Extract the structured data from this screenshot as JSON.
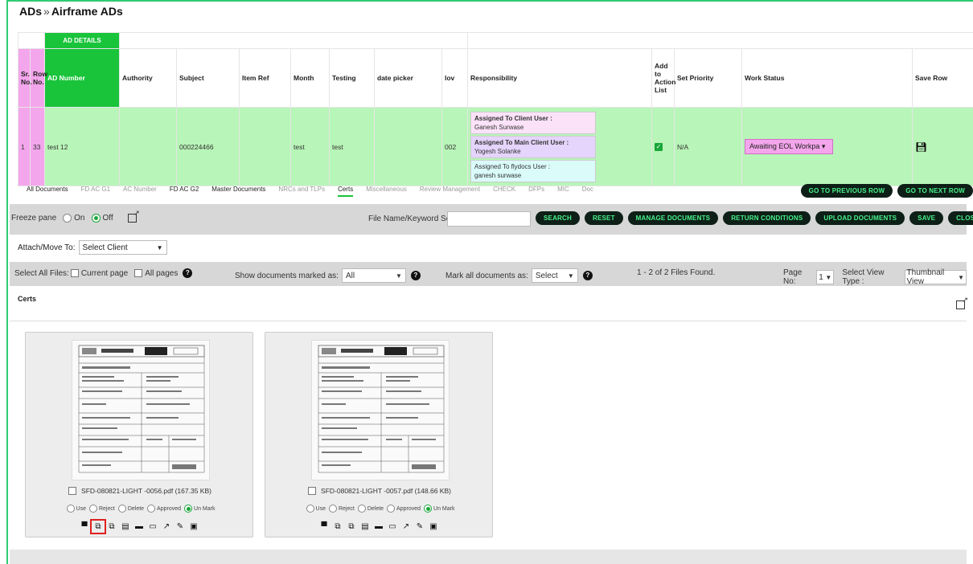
{
  "page": {
    "breadcrumb_parent": "ADs",
    "breadcrumb_sep": "»",
    "breadcrumb_current": "Airframe ADs"
  },
  "grid": {
    "group_header": "AD DETAILS",
    "columns": [
      "Sr. No.",
      "Row No.",
      "AD Number",
      "Authority",
      "Subject",
      "Item Ref",
      "Month",
      "Testing",
      "date picker",
      "lov",
      "Responsibility",
      "Add to Action List",
      "Set Priority",
      "Work Status",
      "Save Row"
    ],
    "row": {
      "sr_no": "1",
      "row_no": "33",
      "ad_number": "test 12",
      "authority": "",
      "subject": "000224466",
      "item_ref": "",
      "month": "test",
      "testing": "test",
      "date_picker": "",
      "lov": "002",
      "resp": [
        {
          "label": "Assigned To Client User :",
          "value": "Ganesh Surwase"
        },
        {
          "label": "Assigned To Main Client User :",
          "value": "Yogesh Solanke"
        },
        {
          "label": "Assigned To flydocs User :",
          "value": "ganesh surwase"
        }
      ],
      "set_priority": "N/A",
      "work_status": "Awaiting EOL Workpa"
    }
  },
  "tabs": [
    "All Documents",
    "FD AC G1",
    "AC Number",
    "FD AC G2",
    "Master Documents",
    "NRCs and TLPs",
    "Certs",
    "Miscellaneous",
    "Review Management",
    "CHECK",
    "DFPs",
    "MIC",
    "Doc"
  ],
  "nav": {
    "prev": "GO TO PREVIOUS ROW",
    "next": "GO TO NEXT ROW"
  },
  "toolbar": {
    "freeze_label": "Freeze pane",
    "on": "On",
    "off": "Off",
    "search_label": "File Name/Keyword Search",
    "search_value": "",
    "buttons": [
      "SEARCH",
      "RESET",
      "MANAGE DOCUMENTS",
      "RETURN CONDITIONS",
      "UPLOAD DOCUMENTS",
      "SAVE",
      "CLOSE"
    ]
  },
  "attach": {
    "label": "Attach/Move To:",
    "value": "Select Client"
  },
  "filters": {
    "select_all": "Select All Files:",
    "current_page": "Current page",
    "all_pages": "All pages",
    "show_marked": "Show documents marked as:",
    "show_value": "All",
    "mark_all": "Mark all documents as:",
    "mark_value": "Select",
    "found": "1 - 2 of 2 Files Found.",
    "page_no": "Page No:",
    "page_value": "1",
    "view_type": "Select View Type :",
    "view_value": "Thumbnail View"
  },
  "section_title": "Certs",
  "cards": [
    {
      "filename": "SFD-080821-LIGHT -0056.pdf (167.35 KB)"
    },
    {
      "filename": "SFD-080821-LIGHT -0057.pdf (148.66 KB)"
    }
  ],
  "doc_options": [
    "Use",
    "Reject",
    "Delete",
    "Approved",
    "Un Mark"
  ],
  "colors": {
    "green": "#19c43a",
    "pink": "#f4a6ec",
    "row_bg": "#b8f5b8",
    "pill_bg": "#0d1f17",
    "pill_text": "#48f28a"
  }
}
